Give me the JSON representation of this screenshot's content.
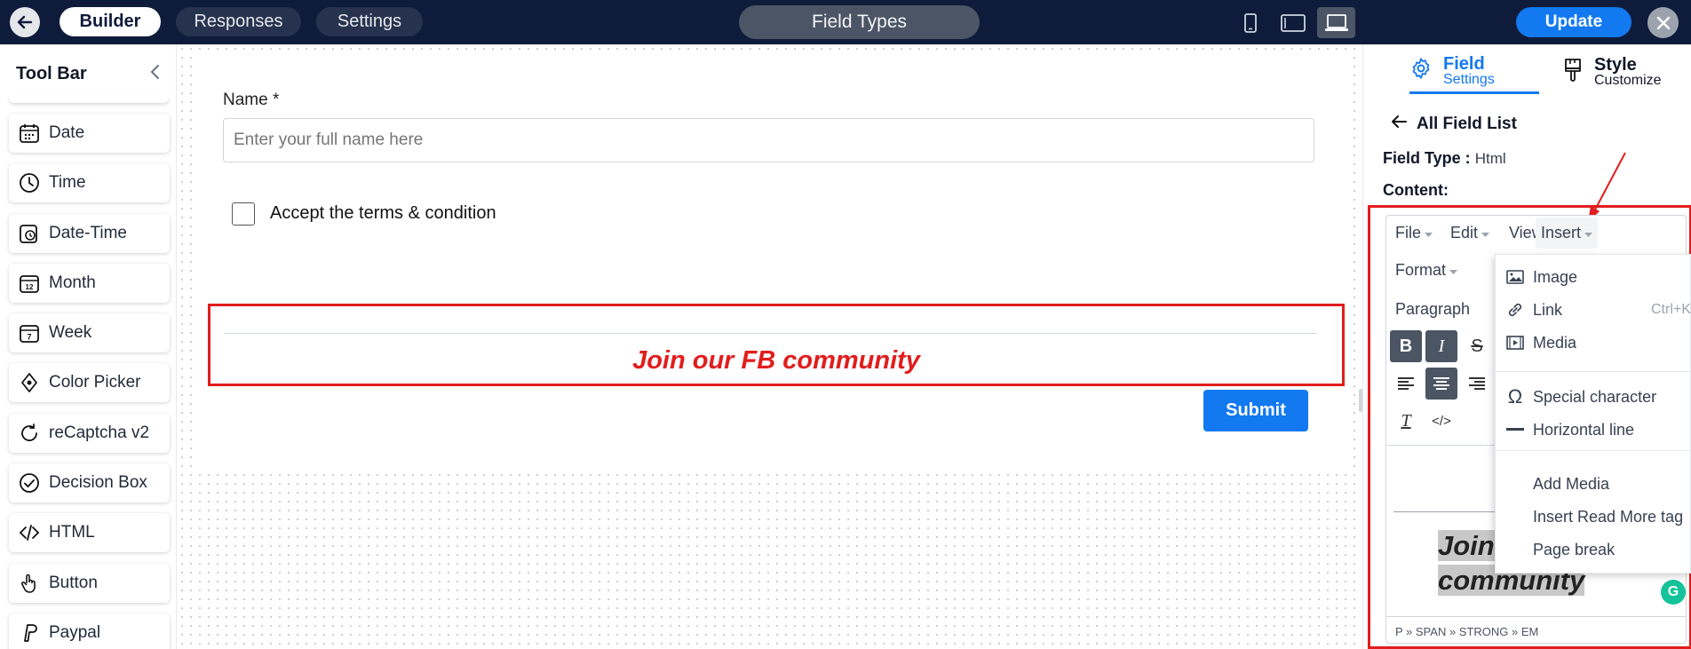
{
  "topbar": {
    "tabs": [
      {
        "label": "Builder"
      },
      {
        "label": "Responses"
      },
      {
        "label": "Settings"
      }
    ],
    "center_title": "Field Types",
    "update_label": "Update",
    "icons": {
      "back": "arrow-left-icon",
      "close": "close-icon",
      "devices": [
        "mobile-icon",
        "tablet-icon",
        "desktop-icon"
      ]
    }
  },
  "toolbar": {
    "title": "Tool Bar",
    "items": [
      {
        "label": "Date",
        "icon": "calendar-icon"
      },
      {
        "label": "Time",
        "icon": "clock-icon"
      },
      {
        "label": "Date-Time",
        "icon": "calendar-clock-icon"
      },
      {
        "label": "Month",
        "icon": "calendar-month-icon"
      },
      {
        "label": "Week",
        "icon": "calendar-week-icon"
      },
      {
        "label": "Color Picker",
        "icon": "droplet-icon"
      },
      {
        "label": "reCaptcha v2",
        "icon": "recaptcha-icon"
      },
      {
        "label": "Decision Box",
        "icon": "check-circle-icon"
      },
      {
        "label": "HTML",
        "icon": "code-icon"
      },
      {
        "label": "Button",
        "icon": "pointer-hand-icon"
      },
      {
        "label": "Paypal",
        "icon": "paypal-icon"
      }
    ]
  },
  "form": {
    "name_label": "Name *",
    "name_placeholder": "Enter your full name here",
    "terms_label": "Accept the terms & condition",
    "html_text": "Join our FB community",
    "submit_label": "Submit"
  },
  "panel": {
    "tabs": [
      {
        "title": "Field",
        "sub": "Settings"
      },
      {
        "title": "Style",
        "sub": "Customize"
      }
    ],
    "all_fields": "All Field List",
    "field_type_key": "Field Type :",
    "field_type_value": "Html",
    "content_label": "Content:"
  },
  "editor": {
    "menu": {
      "file": "File",
      "edit": "Edit",
      "view": "View",
      "insert": "Insert",
      "format": "Format"
    },
    "block_format": "Paragraph",
    "buttons": {
      "bold": "B",
      "italic": "I",
      "strike": "S",
      "clear": "T",
      "code": "</>"
    },
    "content_line1": "Join our FB",
    "content_line2": "community",
    "statusbar": "P » SPAN » STRONG » EM",
    "grammarly": "G"
  },
  "insert_menu": {
    "items": [
      {
        "label": "Image",
        "icon": "image-icon"
      },
      {
        "label": "Link",
        "icon": "link-icon",
        "shortcut": "Ctrl+K"
      },
      {
        "label": "Media",
        "icon": "film-icon"
      },
      {
        "label": "Special character",
        "icon": "omega-icon"
      },
      {
        "label": "Horizontal line",
        "icon": "horizontal-line-icon"
      },
      {
        "label": "Add Media"
      },
      {
        "label": "Insert Read More tag"
      },
      {
        "label": "Page break"
      }
    ]
  },
  "colors": {
    "accent": "#1279f0",
    "topbar": "#0f1b3a",
    "highlight": "#e11d1d"
  }
}
